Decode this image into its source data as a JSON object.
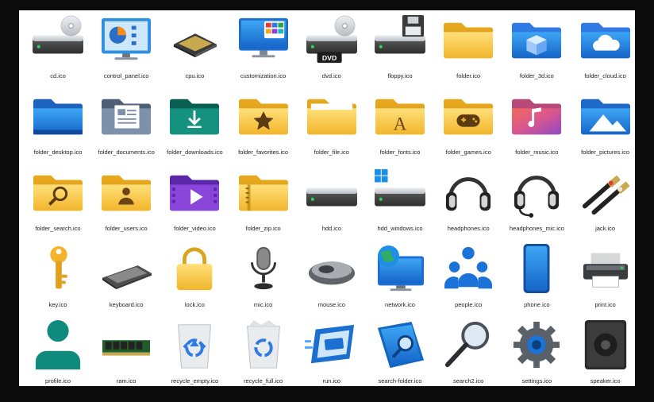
{
  "icons": [
    {
      "file": "cd.ico",
      "icon": "cd-drive"
    },
    {
      "file": "control_panel.ico",
      "icon": "control-panel"
    },
    {
      "file": "cpu.ico",
      "icon": "cpu"
    },
    {
      "file": "customization.ico",
      "icon": "customization"
    },
    {
      "file": "dvd.ico",
      "icon": "dvd-drive",
      "badge": "DVD"
    },
    {
      "file": "floppy.ico",
      "icon": "floppy-drive"
    },
    {
      "file": "folder.ico",
      "icon": "folder"
    },
    {
      "file": "folder_3d.ico",
      "icon": "folder-3d"
    },
    {
      "file": "folder_cloud.ico",
      "icon": "folder-cloud"
    },
    {
      "file": "folder_desktop.ico",
      "icon": "folder-desktop"
    },
    {
      "file": "folder_documents.ico",
      "icon": "folder-documents"
    },
    {
      "file": "folder_downloads.ico",
      "icon": "folder-downloads"
    },
    {
      "file": "folder_favorites.ico",
      "icon": "folder-favorites"
    },
    {
      "file": "folder_file.ico",
      "icon": "folder-file"
    },
    {
      "file": "folder_fonts.ico",
      "icon": "folder-fonts",
      "glyph": "A"
    },
    {
      "file": "folder_games.ico",
      "icon": "folder-games"
    },
    {
      "file": "folder_music.ico",
      "icon": "folder-music"
    },
    {
      "file": "folder_pictures.ico",
      "icon": "folder-pictures"
    },
    {
      "file": "folder_search.ico",
      "icon": "folder-search"
    },
    {
      "file": "folder_users.ico",
      "icon": "folder-users"
    },
    {
      "file": "folder_video.ico",
      "icon": "folder-video"
    },
    {
      "file": "folder_zip.ico",
      "icon": "folder-zip"
    },
    {
      "file": "hdd.ico",
      "icon": "hard-drive"
    },
    {
      "file": "hdd_windows.ico",
      "icon": "hard-drive-windows"
    },
    {
      "file": "headphones.ico",
      "icon": "headphones"
    },
    {
      "file": "headphones_mic.ico",
      "icon": "headset-mic"
    },
    {
      "file": "jack.ico",
      "icon": "audio-jack"
    },
    {
      "file": "key.ico",
      "icon": "key"
    },
    {
      "file": "keyboard.ico",
      "icon": "keyboard"
    },
    {
      "file": "lock.ico",
      "icon": "lock"
    },
    {
      "file": "mic.ico",
      "icon": "microphone"
    },
    {
      "file": "mouse.ico",
      "icon": "mouse"
    },
    {
      "file": "network.ico",
      "icon": "network"
    },
    {
      "file": "people.ico",
      "icon": "people"
    },
    {
      "file": "phone.ico",
      "icon": "phone"
    },
    {
      "file": "print.ico",
      "icon": "printer"
    },
    {
      "file": "profile.ico",
      "icon": "profile"
    },
    {
      "file": "ram.ico",
      "icon": "ram"
    },
    {
      "file": "recycle_empty.ico",
      "icon": "recycle-bin-empty"
    },
    {
      "file": "recycle_full.ico",
      "icon": "recycle-bin-full"
    },
    {
      "file": "run.ico",
      "icon": "run"
    },
    {
      "file": "search-folder.ico",
      "icon": "search-folder"
    },
    {
      "file": "search2.ico",
      "icon": "magnifier"
    },
    {
      "file": "settings.ico",
      "icon": "settings-gear"
    },
    {
      "file": "speaker.ico",
      "icon": "speaker"
    }
  ],
  "colors": {
    "background": "#0b0b0b",
    "panel": "#ffffff",
    "folder_yellow": "#f7c843",
    "folder_blue": "#1f7fd6",
    "folder_teal": "#0e7d6e",
    "folder_purple": "#7a3ed0",
    "drive_gray": "#4a4a4a",
    "status_green": "#27d35a",
    "accent_blue": "#1b73d9"
  }
}
